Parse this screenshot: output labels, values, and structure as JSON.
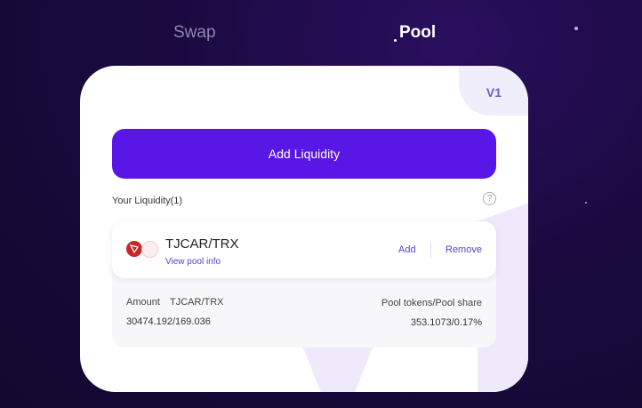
{
  "tabs": {
    "swap": "Swap",
    "pool": "Pool"
  },
  "card": {
    "version": "V1",
    "add_liquidity_label": "Add Liquidity",
    "your_liquidity": "Your Liquidity(1)",
    "help_icon": "?",
    "pool": {
      "pair": "TJCAR/TRX",
      "view_info": "View pool info",
      "add_label": "Add",
      "remove_label": "Remove",
      "amount_label": "Amount",
      "amount_pair": "TJCAR/TRX",
      "amount_value": "30474.192/169.036",
      "share_label": "Pool tokens/Pool share",
      "share_value": "353.1073/0.17%"
    }
  },
  "colors": {
    "accent": "#5817e6",
    "link": "#5a3fd0",
    "background": "#1a0a3f"
  },
  "icons": [
    "tron-token-icon",
    "tjcar-token-icon",
    "help-icon"
  ]
}
